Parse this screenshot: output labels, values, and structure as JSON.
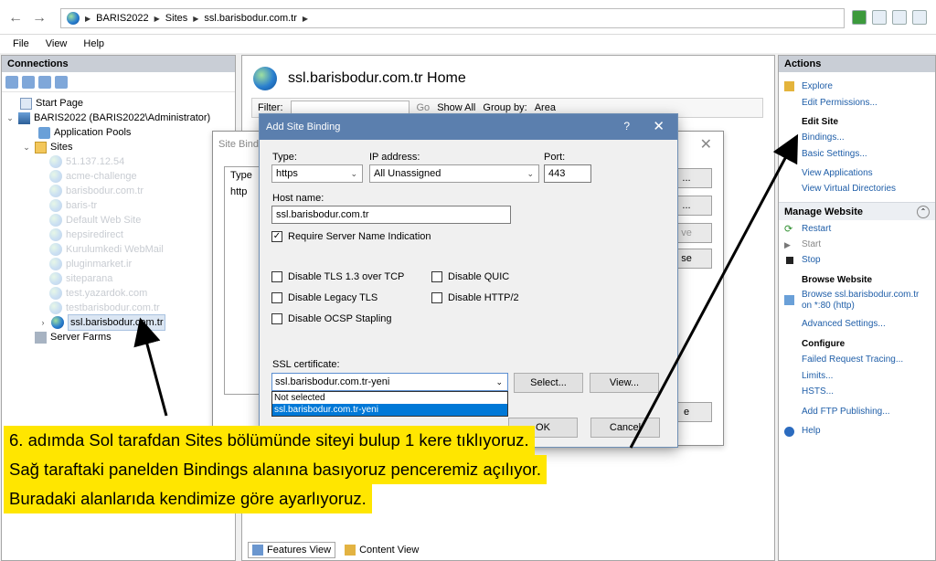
{
  "address": {
    "crumbs": [
      "BARIS2022",
      "Sites",
      "ssl.barisbodur.com.tr"
    ]
  },
  "menu": [
    "File",
    "View",
    "Help"
  ],
  "connections": {
    "title": "Connections",
    "start_page": "Start Page",
    "server": "BARIS2022 (BARIS2022\\Administrator)",
    "app_pools": "Application Pools",
    "sites": "Sites",
    "faded_sites": [
      "51.137.12.54",
      "acme-challenge",
      "barisbodur.com.tr",
      "baris-tr",
      "Default Web Site",
      "hepsiredirect",
      "Kurulumkedi WebMail",
      "pluginmarket.ir",
      "siteparana",
      "test.yazardok.com",
      "testbarisbodur.com.tr"
    ],
    "selected_site": "ssl.barisbodur.com.tr",
    "server_farms": "Server Farms"
  },
  "center": {
    "title": "ssl.barisbodur.com.tr Home",
    "filter_label": "Filter:",
    "go": "Go",
    "show_all": "Show All",
    "group_by_label": "Group by:",
    "group_by_value": "Area",
    "tab_features": "Features View",
    "tab_content": "Content View"
  },
  "site_bindings": {
    "title": "Site Bindings",
    "col_type": "Type",
    "row_type": "http",
    "btn_add": "...",
    "btn_edit": "...",
    "btn_remove": "ve",
    "btn_browse": "se",
    "btn_close": "e"
  },
  "add_binding": {
    "title": "Add Site Binding",
    "help": "?",
    "type_label": "Type:",
    "type_value": "https",
    "ip_label": "IP address:",
    "ip_value": "All Unassigned",
    "port_label": "Port:",
    "port_value": "443",
    "host_label": "Host name:",
    "host_value": "ssl.barisbodur.com.tr",
    "sni": "Require Server Name Indication",
    "tls13": "Disable TLS 1.3 over TCP",
    "quic": "Disable QUIC",
    "legacy_tls": "Disable Legacy TLS",
    "http2": "Disable HTTP/2",
    "ocsp": "Disable OCSP Stapling",
    "ssl_label": "SSL certificate:",
    "ssl_value": "ssl.barisbodur.com.tr-yeni",
    "ssl_options": [
      "Not selected",
      "ssl.barisbodur.com.tr-yeni"
    ],
    "select_btn": "Select...",
    "view_btn": "View...",
    "ok_btn": "OK",
    "cancel_btn": "Cancel"
  },
  "actions": {
    "title": "Actions",
    "explore": "Explore",
    "edit_permissions": "Edit Permissions...",
    "edit_site": "Edit Site",
    "bindings": "Bindings...",
    "basic_settings": "Basic Settings...",
    "view_applications": "View Applications",
    "view_vdirs": "View Virtual Directories",
    "manage_website": "Manage Website",
    "restart": "Restart",
    "start": "Start",
    "stop": "Stop",
    "browse_website": "Browse Website",
    "browse_link_1": "Browse ssl.barisbodur.com.tr",
    "browse_link_2": "on *:80 (http)",
    "advanced_settings": "Advanced Settings...",
    "configure": "Configure",
    "failed_request": "Failed Request Tracing...",
    "limits": "Limits...",
    "hsts": "HSTS...",
    "add_ftp": "Add FTP Publishing...",
    "help": "Help"
  },
  "caption": {
    "line1": "6. adımda Sol tarafdan Sites bölümünde siteyi bulup 1 kere tıklıyoruz.",
    "line2": "Sağ taraftaki panelden Bindings alanına basıyoruz penceremiz açılıyor.",
    "line3": "Buradaki alanlarıda kendimize göre ayarlıyoruz."
  },
  "colors": {
    "caption_bg": "#ffe600",
    "dialog_title": "#5b7fae",
    "link": "#1f5ea8"
  }
}
